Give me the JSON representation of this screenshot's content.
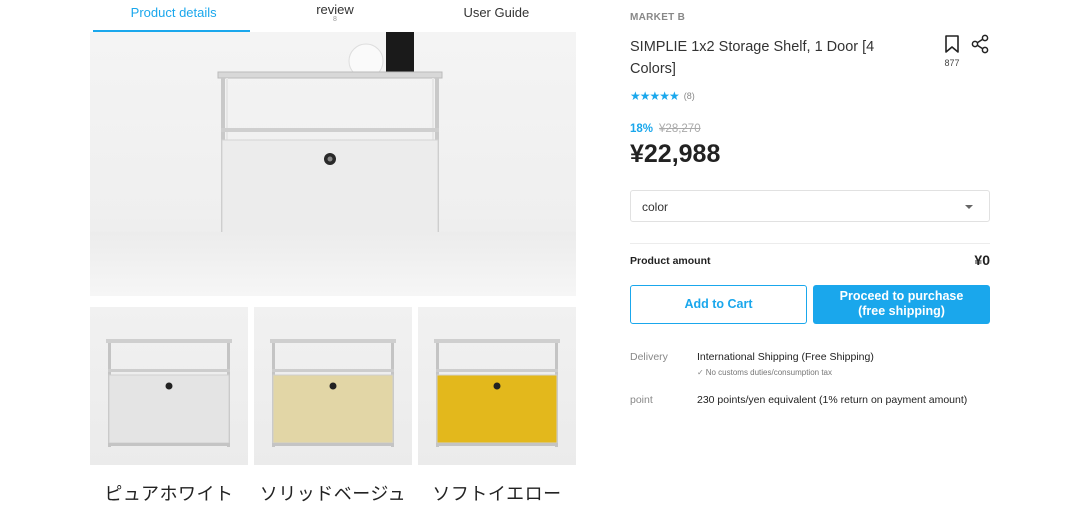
{
  "tabs": [
    {
      "label": "Product details",
      "active": true
    },
    {
      "label": "review",
      "count": "8"
    },
    {
      "label": "User Guide"
    }
  ],
  "thumbnails": [
    {
      "label": "ピュアホワイト",
      "panel_color": "#e4e4e4"
    },
    {
      "label": "ソリッドベージュ",
      "panel_color": "#e2d6a6"
    },
    {
      "label": "ソフトイエロー",
      "panel_color": "#e3b81c"
    }
  ],
  "product": {
    "seller": "MARKET B",
    "title": "SIMPLIE 1x2 Storage Shelf, 1 Door [4 Colors]",
    "bookmark_count": "877",
    "rating_stars": "★★★★★",
    "review_count": "(8)",
    "discount": "18%",
    "original_price": "¥28,270",
    "price": "¥22,988"
  },
  "option": {
    "placeholder": "color"
  },
  "amount": {
    "label": "Product amount",
    "value": "¥0"
  },
  "buttons": {
    "add_to_cart": "Add to Cart",
    "purchase_line1": "Proceed to purchase",
    "purchase_line2": "(free shipping)"
  },
  "delivery": {
    "label": "Delivery",
    "value": "International Shipping (Free Shipping)",
    "sub": "No customs duties/consumption tax"
  },
  "point": {
    "label": "point",
    "value": "230 points/yen equivalent (1% return on payment amount)"
  },
  "colors": {
    "accent": "#1aa7ec"
  },
  "icons": {
    "bookmark": "bookmark-icon",
    "share": "share-icon",
    "check": "check-icon",
    "caret": "chevron-down-icon"
  }
}
